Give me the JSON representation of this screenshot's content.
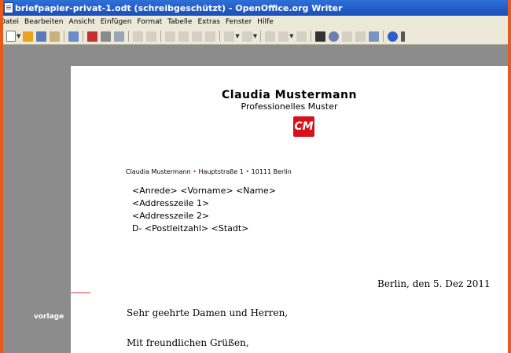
{
  "window": {
    "title": "briefpapier-privat-1.odt (schreibgeschützt) - OpenOffice.org Writer"
  },
  "menu": {
    "items": [
      "Datei",
      "Bearbeiten",
      "Ansicht",
      "Einfügen",
      "Format",
      "Tabelle",
      "Extras",
      "Fenster",
      "Hilfe"
    ]
  },
  "document": {
    "sender_name": "Claudia Mustermann",
    "sender_subtitle": "Professionelles Muster",
    "logo_text": "CM",
    "return_line": {
      "name": "Claudia Mustermann",
      "street": "Hauptstraße 1",
      "city": "10111 Berlin"
    },
    "address": {
      "line1": "<Anrede> <Vorname> <Name>",
      "line2": "<Addresszeile 1>",
      "line3": "<Addresszeile 2>",
      "line4": "D- <Postleitzahl> <Stadt>"
    },
    "date_line": "Berlin, den 5. Dez 2011",
    "salutation": "Sehr geehrte Damen und Herren,",
    "closing": "Mit freundlichen Grüßen,"
  },
  "watermark": "vorlage",
  "colors": {
    "frame": "#e8591c",
    "titlebar": "#2f6fd8",
    "logo": "#d8111a",
    "workspace": "#8c8c8c"
  }
}
